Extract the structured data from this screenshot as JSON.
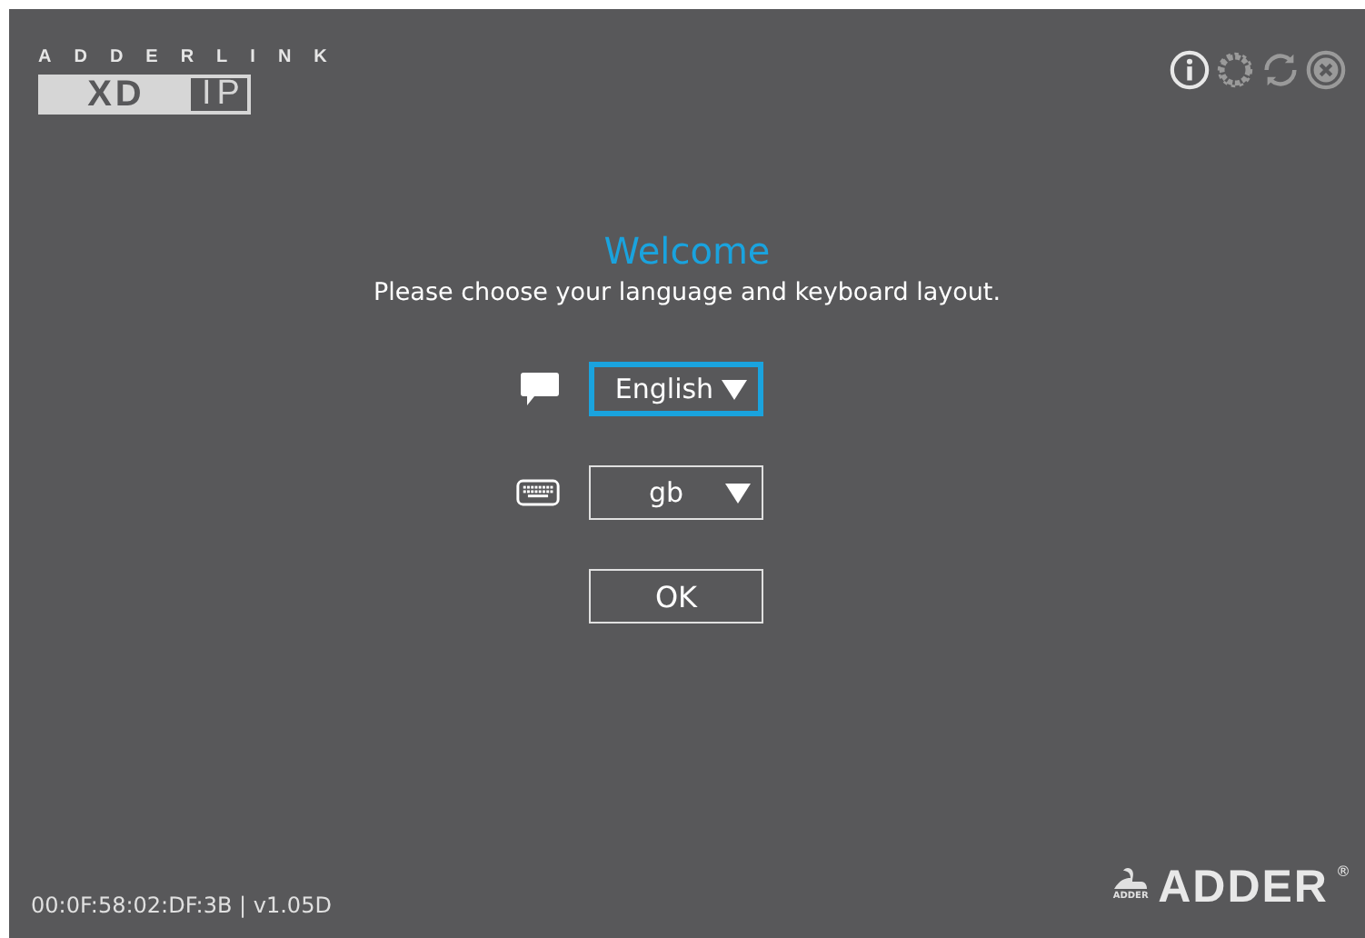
{
  "logo": {
    "top": "ADDERLINK",
    "inverted": "XD",
    "plain": "IP"
  },
  "toolbar": [
    {
      "kind": "info",
      "disabled": false
    },
    {
      "kind": "settings",
      "disabled": true
    },
    {
      "kind": "refresh",
      "disabled": true
    },
    {
      "kind": "close",
      "disabled": true
    }
  ],
  "title": "Welcome",
  "subtitle": "Please choose your language and keyboard layout.",
  "fields": [
    {
      "kind": "language",
      "value": "English",
      "focused": true
    },
    {
      "kind": "keyboard",
      "value": "gb",
      "focused": false
    }
  ],
  "ok_button": "OK",
  "footer": {
    "status": "00:0F:58:02:DF:3B | v1.05D",
    "brand": "ADDER",
    "brand_small": "ADDER",
    "registered": "®"
  }
}
